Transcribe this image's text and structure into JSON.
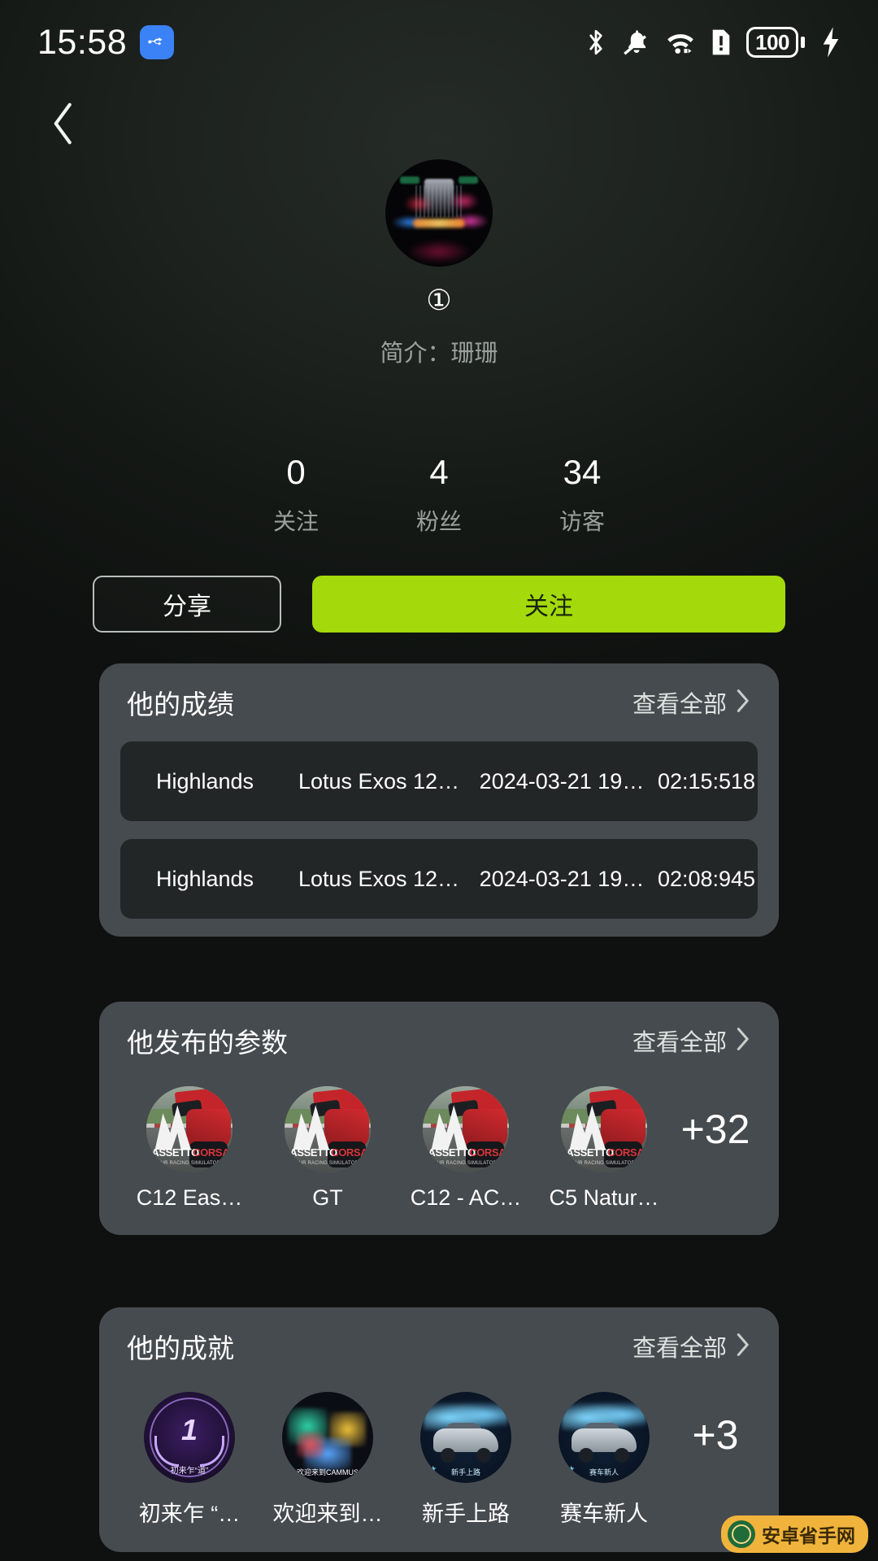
{
  "statusbar": {
    "time": "15:58",
    "usb_icon": "usb-icon",
    "bluetooth_icon": "bluetooth-icon",
    "mute_icon": "bell-muted-icon",
    "wifi_icon": "wifi-icon",
    "sim_alert_icon": "sim-alert-icon",
    "battery_level": "100",
    "charging_icon": "lightning-bolt-icon"
  },
  "nav": {
    "back_icon": "chevron-left-icon"
  },
  "profile": {
    "avatar_alt": "avatar",
    "username": "①",
    "bio": "简介：珊珊"
  },
  "stats": [
    {
      "value": "0",
      "label": "关注"
    },
    {
      "value": "4",
      "label": "粉丝"
    },
    {
      "value": "34",
      "label": "访客"
    }
  ],
  "actions": {
    "share_label": "分享",
    "follow_label": "关注",
    "follow_color": "#a4d90c"
  },
  "results_card": {
    "title": "他的成绩",
    "more_label": "查看全部",
    "more_icon": "chevron-right-icon",
    "rows": [
      {
        "track": "Highlands",
        "car": "Lotus Exos 12…",
        "date": "2024-03-21 19…",
        "time": "02:15:518"
      },
      {
        "track": "Highlands",
        "car": "Lotus Exos 12…",
        "date": "2024-03-21 19…",
        "time": "02:08:945"
      }
    ]
  },
  "params_card": {
    "title": "他发布的参数",
    "more_label": "查看全部",
    "more_icon": "chevron-right-icon",
    "items": [
      {
        "caption": "C12 Eas…",
        "image": "assetto-corsa-thumbnail"
      },
      {
        "caption": "GT",
        "image": "assetto-corsa-thumbnail"
      },
      {
        "caption": "C12 - AC…",
        "image": "assetto-corsa-thumbnail"
      },
      {
        "caption": "C5 Natur…",
        "image": "assetto-corsa-thumbnail"
      }
    ],
    "overflow": "+32"
  },
  "achievements_card": {
    "title": "他的成就",
    "more_label": "查看全部",
    "more_icon": "chevron-right-icon",
    "items": [
      {
        "caption": "初来乍 “…",
        "badge_text": "1",
        "badge_sub": "初来乍“道”"
      },
      {
        "caption": "欢迎来到…",
        "badge_text": "",
        "badge_sub": "欢迎来到CAMMUS"
      },
      {
        "caption": "新手上路",
        "badge_text": "",
        "badge_sub": "新手上路"
      },
      {
        "caption": "赛车新人",
        "badge_text": "",
        "badge_sub": "赛车新人"
      }
    ],
    "overflow": "+3"
  },
  "watermark": {
    "text": "安卓省手网",
    "icon": "globe-icon"
  }
}
